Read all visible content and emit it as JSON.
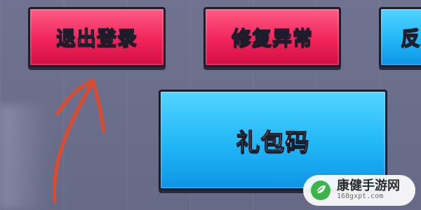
{
  "buttons": {
    "logout": "退出登录",
    "repair": "修复异常",
    "partial": "反",
    "gift_code": "礼包码"
  },
  "watermark": {
    "title": "康健手游网",
    "subtitle": "168gxpt.com"
  },
  "colors": {
    "red_button": "#f0245a",
    "blue_button": "#21b7f6",
    "background": "#6a6e8a",
    "arrow": "#e04a2a"
  },
  "icons": {
    "arrow": "hand-drawn-arrow-icon",
    "watermark_logo": "leaf-logo-icon"
  }
}
